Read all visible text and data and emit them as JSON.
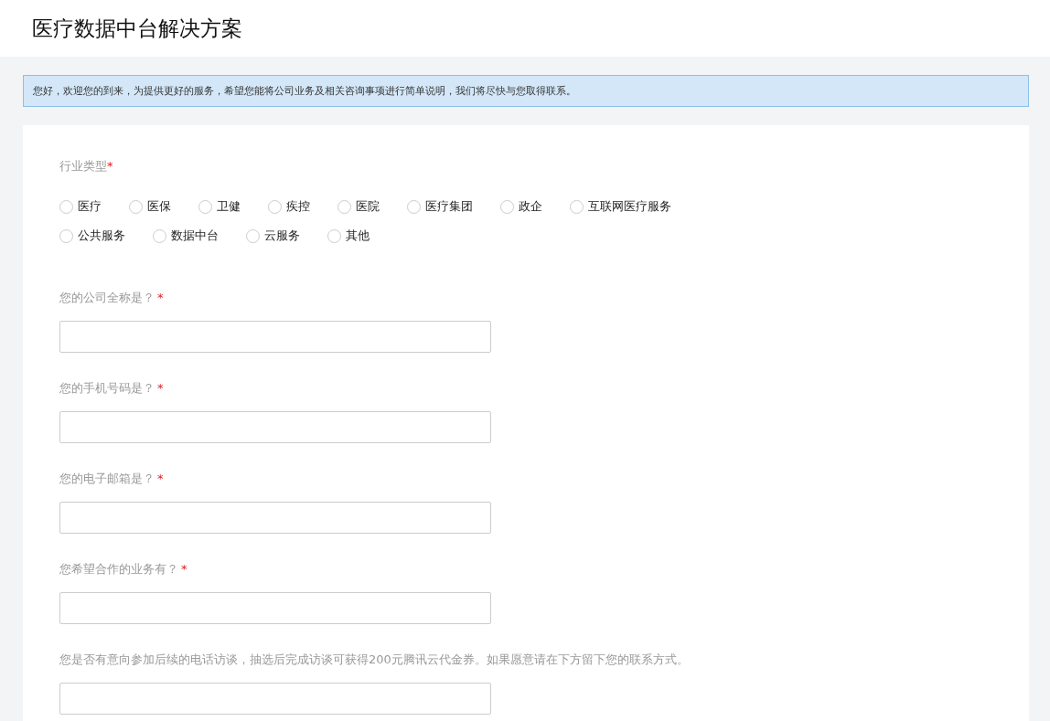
{
  "header": {
    "title": "医疗数据中台解决方案"
  },
  "notice": "您好，欢迎您的到来，为提供更好的服务，希望您能将公司业务及相关咨询事项进行简单说明，我们将尽快与您取得联系。",
  "industry": {
    "label": "行业类型",
    "required_mark": "*",
    "options": [
      {
        "label": "医疗",
        "selected": false
      },
      {
        "label": "医保",
        "selected": false
      },
      {
        "label": "卫健",
        "selected": false
      },
      {
        "label": "疾控",
        "selected": false
      },
      {
        "label": "医院",
        "selected": false
      },
      {
        "label": "医疗集团",
        "selected": false
      },
      {
        "label": "政企",
        "selected": false
      },
      {
        "label": "互联网医疗服务",
        "selected": false
      },
      {
        "label": "公共服务",
        "selected": false
      },
      {
        "label": "数据中台",
        "selected": false
      },
      {
        "label": "云服务",
        "selected": false
      },
      {
        "label": "其他",
        "selected": false
      }
    ]
  },
  "questions": [
    {
      "label": "您的公司全称是？",
      "required_mark": "*"
    },
    {
      "label": "您的手机号码是？",
      "required_mark": "*"
    },
    {
      "label": "您的电子邮箱是？",
      "required_mark": "*"
    },
    {
      "label": "您希望合作的业务有？",
      "required_mark": "*"
    },
    {
      "label": "您是否有意向参加后续的电话访谈，抽选后完成访谈可获得200元腾讯云代金券。如果愿意请在下方留下您的联系方式。"
    }
  ]
}
